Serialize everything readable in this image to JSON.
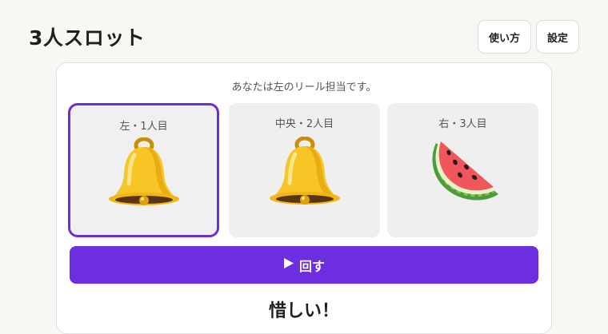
{
  "app": {
    "title": "3人スロット"
  },
  "header": {
    "howto_label": "使い方",
    "settings_label": "設定"
  },
  "game": {
    "player_note": "あなたは左のリール担当です。",
    "reels": [
      {
        "label": "左・1人目",
        "symbol": "bell-icon",
        "mine": true
      },
      {
        "label": "中央・2人目",
        "symbol": "bell-icon",
        "mine": false
      },
      {
        "label": "右・3人目",
        "symbol": "watermelon-icon",
        "mine": false
      }
    ],
    "spin_label": "回す",
    "spin_icon": "play-icon",
    "result_text": "惜しい！"
  },
  "colors": {
    "accent": "#6d2ee0",
    "page_background": "#f8f7f4"
  }
}
